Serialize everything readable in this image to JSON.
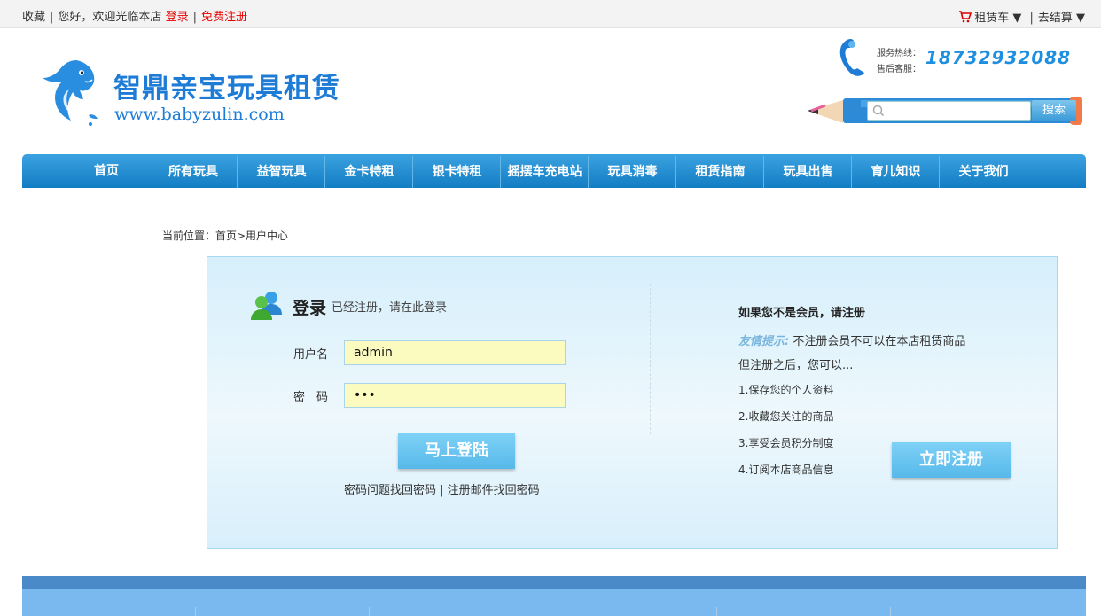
{
  "topbar": {
    "favorite": "收藏",
    "greeting": "您好，欢迎光临本店",
    "login": "登录",
    "register": "免费注册",
    "cart": "租赁车 ▼",
    "checkout": "去结算 ▼"
  },
  "header": {
    "brand": "智鼎亲宝玩具租赁",
    "site": "www.babyzulin.com",
    "hotline_label": "服务热线：",
    "service_label": "售后客服：",
    "hotline": "18732932088",
    "search_placeholder": "",
    "search_button": "搜索"
  },
  "nav": {
    "items": [
      "首页",
      "所有玩具",
      "益智玩具",
      "金卡特租",
      "银卡特租",
      "摇摆车充电站",
      "玩具消毒",
      "租赁指南",
      "玩具出售",
      "育儿知识",
      "关于我们"
    ]
  },
  "breadcrumb": "当前位置：首页>用户中心",
  "login": {
    "title": "登录",
    "subtitle": "已经注册，请在此登录",
    "username_label": "用户名",
    "password_label": "密码",
    "username_value": "admin",
    "password_value": "•••",
    "submit": "马上登陆",
    "recover": "密码问题找回密码 | 注册邮件找回密码"
  },
  "register": {
    "title": "如果您不是会员，请注册",
    "tip_label": "友情提示:",
    "tip_text": "不注册会员不可以在本店租赁商品",
    "tip_more": "但注册之后，您可以...",
    "benefits": [
      "1.保存您的个人资料",
      "2.收藏您关注的商品",
      "3.享受会员积分制度",
      "4.订阅本店商品信息"
    ],
    "button": "立即注册"
  },
  "colors": {
    "nav": "#137dc4",
    "brand": "#1e7cd6",
    "accent_red": "#e60000",
    "button": "#57b9ea"
  }
}
